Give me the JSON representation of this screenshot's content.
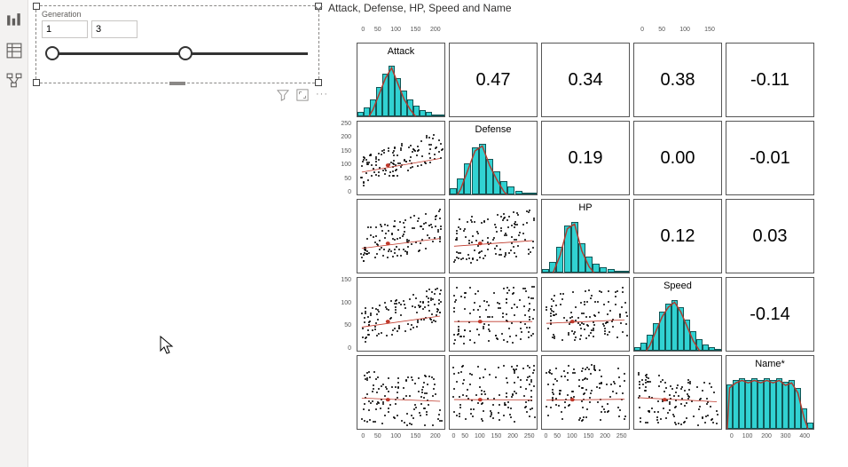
{
  "left_rail": {
    "icons": [
      "report-icon",
      "data-icon",
      "model-icon"
    ]
  },
  "slicer": {
    "title": "Generation",
    "min_value": "1",
    "max_value": "3"
  },
  "visual_tools": [
    "filter-icon",
    "focus-mode-icon",
    "more-icon"
  ],
  "chart_title": "Attack, Defense, HP, Speed and Name",
  "chart_data": {
    "type": "scatter_matrix",
    "variables": [
      "Attack",
      "Defense",
      "HP",
      "Speed",
      "Name*"
    ],
    "correlations": {
      "Attack-Defense": 0.47,
      "Attack-HP": 0.34,
      "Attack-Speed": 0.38,
      "Attack-Name*": -0.11,
      "Defense-HP": 0.19,
      "Defense-Speed": 0.0,
      "Defense-Name*": -0.01,
      "HP-Speed": 0.12,
      "HP-Name*": 0.03,
      "Speed-Name*": -0.14
    },
    "diag_histograms": {
      "Attack": {
        "bins": [
          2,
          4,
          8,
          14,
          20,
          24,
          18,
          12,
          8,
          5,
          3,
          2,
          1,
          1
        ]
      },
      "Defense": {
        "bins": [
          3,
          8,
          16,
          24,
          26,
          18,
          12,
          7,
          4,
          2,
          1,
          1
        ]
      },
      "HP": {
        "bins": [
          2,
          6,
          14,
          26,
          28,
          16,
          9,
          5,
          3,
          2,
          1,
          1
        ]
      },
      "Speed": {
        "bins": [
          2,
          4,
          8,
          14,
          20,
          24,
          26,
          22,
          16,
          10,
          6,
          3,
          2,
          1
        ]
      },
      "Name*": {
        "bins": [
          22,
          24,
          25,
          24,
          25,
          24,
          25,
          24,
          25,
          23,
          24,
          20,
          10,
          3
        ]
      }
    },
    "axes": {
      "Attack": {
        "ticks": [
          0,
          50,
          100,
          150,
          200
        ]
      },
      "Defense": {
        "ticks": [
          0,
          50,
          100,
          150,
          200,
          250
        ]
      },
      "HP": {
        "ticks": [
          0,
          50,
          100,
          150,
          200,
          250
        ]
      },
      "Speed": {
        "ticks": [
          0,
          50,
          100,
          150
        ]
      },
      "Name*": {
        "ticks": [
          0,
          100,
          200,
          300,
          400
        ]
      }
    },
    "right_axes": {
      "Attack": [
        0,
        50,
        100,
        150
      ],
      "Defense": [
        0,
        50,
        100,
        150,
        200,
        250
      ],
      "HP": [
        0,
        100,
        150,
        200,
        250
      ],
      "Speed": [],
      "Name*": [
        0,
        100,
        200,
        300,
        400
      ]
    },
    "hist_color": "#31d2d2",
    "trend_color": "#c0392b"
  }
}
